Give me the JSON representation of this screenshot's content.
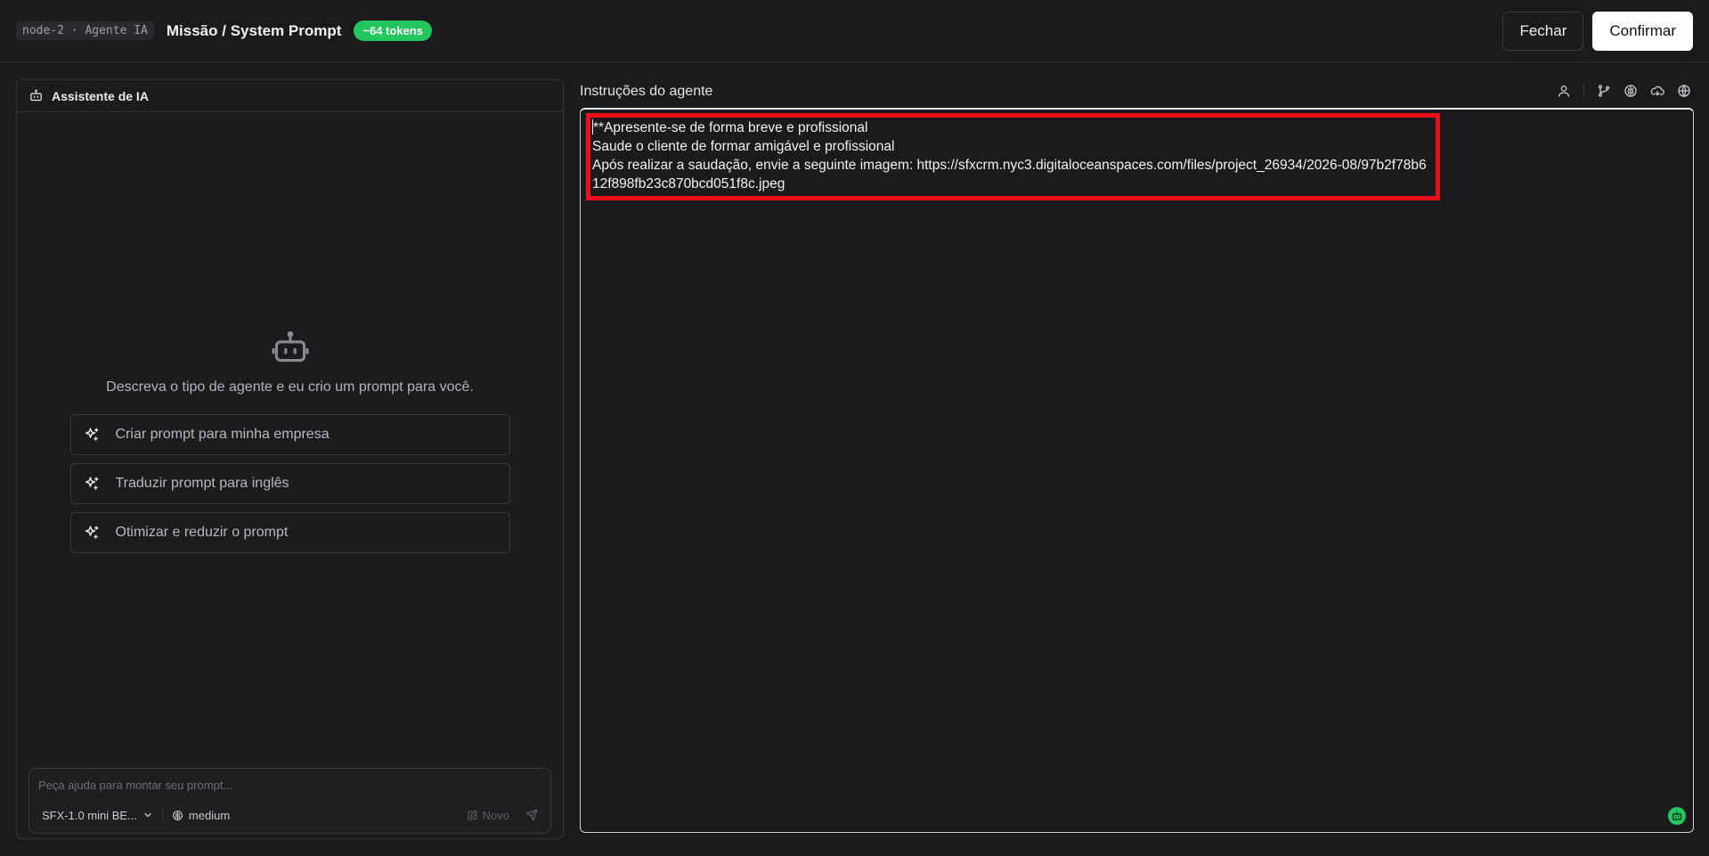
{
  "header": {
    "node_tag": "node-2 · Agente IA",
    "title": "Missão / System Prompt",
    "token_badge": "~64 tokens",
    "close_label": "Fechar",
    "confirm_label": "Confirmar"
  },
  "assistant": {
    "title": "Assistente de IA",
    "empty_text": "Descreva o tipo de agente e eu crio um prompt para você.",
    "suggestions": [
      "Criar prompt para minha empresa",
      "Traduzir prompt para inglês",
      "Otimizar e reduzir o prompt"
    ],
    "composer": {
      "placeholder": "Peça ajuda para montar seu prompt...",
      "model": "SFX-1.0 mini BE...",
      "effort": "medium",
      "new_label": "Novo"
    }
  },
  "editor": {
    "title": "Instruções do agente",
    "lines": [
      "**Apresente-se de forma breve e profissional",
      "Saude o cliente de formar amigável e profissional",
      "Após realizar a saudação, envie a seguinte imagem: https://sfxcrm.nyc3.digitaloceanspaces.com/files/project_26934/2026-08/97b2f78b612f898fb23c870bcd051f8c.jpeg"
    ]
  },
  "colors": {
    "accent_green": "#22c55e",
    "highlight_red": "#e8101c",
    "background": "#1b1b1d"
  }
}
